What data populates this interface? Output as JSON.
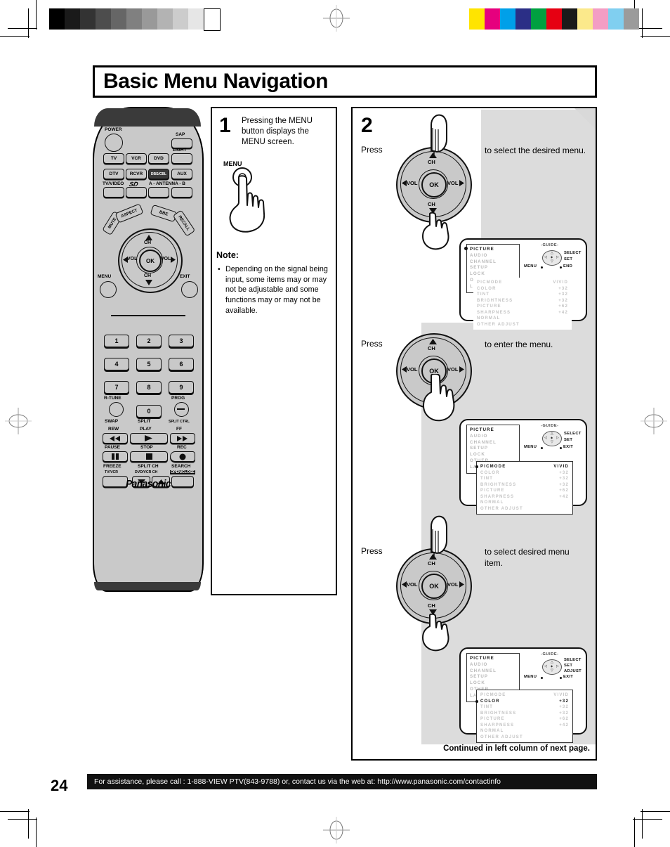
{
  "page": {
    "title": "Basic Menu Navigation",
    "number": "24",
    "footer": "For assistance, please call : 1-888-VIEW PTV(843-9788) or, contact us via the web at: http://www.panasonic.com/contactinfo",
    "continued": "Continued in left column of next page."
  },
  "calibration": {
    "gray_bars": [
      "#000000",
      "#1a1a1a",
      "#333333",
      "#4d4d4d",
      "#666666",
      "#808080",
      "#999999",
      "#b3b3b3",
      "#cccccc",
      "#e6e6e6",
      "#ffffff"
    ],
    "color_bars": [
      "#ffe400",
      "#e6007e",
      "#00a0e9",
      "#2b2f86",
      "#00a040",
      "#e60012",
      "#1a1a1a",
      "#fbe98b",
      "#f39dc4",
      "#80cff0",
      "#9b9b9b"
    ]
  },
  "remote": {
    "brand": "Panasonic",
    "power_label": "POWER",
    "sap_label": "SAP",
    "light_label": "LIGHT",
    "source_row1": [
      "TV",
      "VCR",
      "DVD"
    ],
    "source_row2": [
      "DTV",
      "RCVR",
      "DBS/CBL",
      "AUX"
    ],
    "tvvideo_label": "TV/VIDEO",
    "sd_label": "SD",
    "antenna_label": "A - ANTENNA - B",
    "tilt_buttons": [
      "MUTE",
      "ASPECT",
      "BBE",
      "RECALL"
    ],
    "wheel": {
      "ch_up": "CH",
      "ch_down": "CH",
      "vol_left": "VOL",
      "vol_right": "VOL",
      "ok": "OK"
    },
    "menu_label": "MENU",
    "exit_label": "EXIT",
    "numbers": [
      "1",
      "2",
      "3",
      "4",
      "5",
      "6",
      "7",
      "8",
      "9",
      "0"
    ],
    "rtune_label": "R-TUNE",
    "prog_label": "PROG",
    "swap_label": "SWAP",
    "split_label": "SPLIT",
    "splitctrl_label": "SPLIT CTRL",
    "rew_label": "REW",
    "play_label": "PLAY",
    "ff_label": "FF",
    "pause_label": "PAUSE",
    "stop_label": "STOP",
    "rec_label": "REC",
    "freeze_label": "FREEZE",
    "tvvcr_label": "TV/VCR",
    "splitch_label": "SPLIT CH",
    "dvdvcrch_label": "DVD/VCR CH",
    "search_label": "SEARCH",
    "openclose_label": "OPEN/CLOSE"
  },
  "step1": {
    "number": "1",
    "text": "Pressing the MENU button displays the MENU screen.",
    "button_label": "MENU",
    "note_heading": "Note:",
    "note_bullet": "•",
    "note_text": "Depending on the signal being input, some items may or may not be adjustable and some functions may or may not be available."
  },
  "step2": {
    "number": "2",
    "substeps": [
      {
        "press": "Press",
        "description": "to select the desired menu."
      },
      {
        "press": "Press",
        "description": "to enter the menu."
      },
      {
        "press": "Press",
        "description": "to select desired menu item."
      }
    ]
  },
  "osd": {
    "menu_items": [
      "PICTURE",
      "AUDIO",
      "CHANNEL",
      "SETUP",
      "LOCK",
      "OTHER",
      "LANGUAGE"
    ],
    "guide_title": "-GUIDE-",
    "guide_menu": "MENU",
    "param_labels": [
      "PICMODE",
      "COLOR",
      "TINT",
      "BRIGHTNESS",
      "PICTURE",
      "SHARPNESS",
      "NORMAL",
      "OTHER  ADJUST"
    ],
    "param_values": [
      "VIVID",
      "+32",
      "+32",
      "+32",
      "+62",
      "+42",
      "",
      ""
    ],
    "screens": [
      {
        "selected_menu": "PICTURE",
        "guide_right": [
          "SELECT",
          "SET"
        ],
        "guide_end": "END",
        "highlight_param": null,
        "params_boxed": false
      },
      {
        "selected_menu": "PICTURE",
        "guide_right": [
          "SELECT",
          "SET"
        ],
        "guide_end": "EXIT",
        "highlight_param": "PICMODE",
        "params_boxed": true
      },
      {
        "selected_menu": "PICTURE",
        "guide_right": [
          "SELECT",
          "SET",
          "ADJUST"
        ],
        "guide_end": "EXIT",
        "highlight_param": "COLOR",
        "params_boxed": true
      }
    ]
  },
  "wheel": {
    "ch": "CH",
    "vol": "VOL",
    "ok": "OK"
  }
}
